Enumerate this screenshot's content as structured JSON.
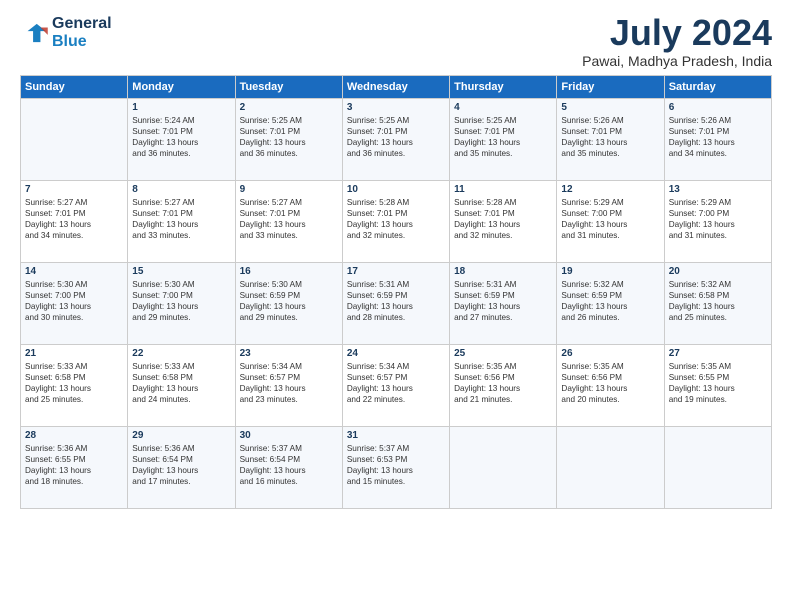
{
  "header": {
    "logo_line1": "General",
    "logo_line2": "Blue",
    "title": "July 2024",
    "location": "Pawai, Madhya Pradesh, India"
  },
  "columns": [
    "Sunday",
    "Monday",
    "Tuesday",
    "Wednesday",
    "Thursday",
    "Friday",
    "Saturday"
  ],
  "weeks": [
    [
      {
        "day": "",
        "content": ""
      },
      {
        "day": "1",
        "content": "Sunrise: 5:24 AM\nSunset: 7:01 PM\nDaylight: 13 hours\nand 36 minutes."
      },
      {
        "day": "2",
        "content": "Sunrise: 5:25 AM\nSunset: 7:01 PM\nDaylight: 13 hours\nand 36 minutes."
      },
      {
        "day": "3",
        "content": "Sunrise: 5:25 AM\nSunset: 7:01 PM\nDaylight: 13 hours\nand 36 minutes."
      },
      {
        "day": "4",
        "content": "Sunrise: 5:25 AM\nSunset: 7:01 PM\nDaylight: 13 hours\nand 35 minutes."
      },
      {
        "day": "5",
        "content": "Sunrise: 5:26 AM\nSunset: 7:01 PM\nDaylight: 13 hours\nand 35 minutes."
      },
      {
        "day": "6",
        "content": "Sunrise: 5:26 AM\nSunset: 7:01 PM\nDaylight: 13 hours\nand 34 minutes."
      }
    ],
    [
      {
        "day": "7",
        "content": "Sunrise: 5:27 AM\nSunset: 7:01 PM\nDaylight: 13 hours\nand 34 minutes."
      },
      {
        "day": "8",
        "content": "Sunrise: 5:27 AM\nSunset: 7:01 PM\nDaylight: 13 hours\nand 33 minutes."
      },
      {
        "day": "9",
        "content": "Sunrise: 5:27 AM\nSunset: 7:01 PM\nDaylight: 13 hours\nand 33 minutes."
      },
      {
        "day": "10",
        "content": "Sunrise: 5:28 AM\nSunset: 7:01 PM\nDaylight: 13 hours\nand 32 minutes."
      },
      {
        "day": "11",
        "content": "Sunrise: 5:28 AM\nSunset: 7:01 PM\nDaylight: 13 hours\nand 32 minutes."
      },
      {
        "day": "12",
        "content": "Sunrise: 5:29 AM\nSunset: 7:00 PM\nDaylight: 13 hours\nand 31 minutes."
      },
      {
        "day": "13",
        "content": "Sunrise: 5:29 AM\nSunset: 7:00 PM\nDaylight: 13 hours\nand 31 minutes."
      }
    ],
    [
      {
        "day": "14",
        "content": "Sunrise: 5:30 AM\nSunset: 7:00 PM\nDaylight: 13 hours\nand 30 minutes."
      },
      {
        "day": "15",
        "content": "Sunrise: 5:30 AM\nSunset: 7:00 PM\nDaylight: 13 hours\nand 29 minutes."
      },
      {
        "day": "16",
        "content": "Sunrise: 5:30 AM\nSunset: 6:59 PM\nDaylight: 13 hours\nand 29 minutes."
      },
      {
        "day": "17",
        "content": "Sunrise: 5:31 AM\nSunset: 6:59 PM\nDaylight: 13 hours\nand 28 minutes."
      },
      {
        "day": "18",
        "content": "Sunrise: 5:31 AM\nSunset: 6:59 PM\nDaylight: 13 hours\nand 27 minutes."
      },
      {
        "day": "19",
        "content": "Sunrise: 5:32 AM\nSunset: 6:59 PM\nDaylight: 13 hours\nand 26 minutes."
      },
      {
        "day": "20",
        "content": "Sunrise: 5:32 AM\nSunset: 6:58 PM\nDaylight: 13 hours\nand 25 minutes."
      }
    ],
    [
      {
        "day": "21",
        "content": "Sunrise: 5:33 AM\nSunset: 6:58 PM\nDaylight: 13 hours\nand 25 minutes."
      },
      {
        "day": "22",
        "content": "Sunrise: 5:33 AM\nSunset: 6:58 PM\nDaylight: 13 hours\nand 24 minutes."
      },
      {
        "day": "23",
        "content": "Sunrise: 5:34 AM\nSunset: 6:57 PM\nDaylight: 13 hours\nand 23 minutes."
      },
      {
        "day": "24",
        "content": "Sunrise: 5:34 AM\nSunset: 6:57 PM\nDaylight: 13 hours\nand 22 minutes."
      },
      {
        "day": "25",
        "content": "Sunrise: 5:35 AM\nSunset: 6:56 PM\nDaylight: 13 hours\nand 21 minutes."
      },
      {
        "day": "26",
        "content": "Sunrise: 5:35 AM\nSunset: 6:56 PM\nDaylight: 13 hours\nand 20 minutes."
      },
      {
        "day": "27",
        "content": "Sunrise: 5:35 AM\nSunset: 6:55 PM\nDaylight: 13 hours\nand 19 minutes."
      }
    ],
    [
      {
        "day": "28",
        "content": "Sunrise: 5:36 AM\nSunset: 6:55 PM\nDaylight: 13 hours\nand 18 minutes."
      },
      {
        "day": "29",
        "content": "Sunrise: 5:36 AM\nSunset: 6:54 PM\nDaylight: 13 hours\nand 17 minutes."
      },
      {
        "day": "30",
        "content": "Sunrise: 5:37 AM\nSunset: 6:54 PM\nDaylight: 13 hours\nand 16 minutes."
      },
      {
        "day": "31",
        "content": "Sunrise: 5:37 AM\nSunset: 6:53 PM\nDaylight: 13 hours\nand 15 minutes."
      },
      {
        "day": "",
        "content": ""
      },
      {
        "day": "",
        "content": ""
      },
      {
        "day": "",
        "content": ""
      }
    ]
  ]
}
